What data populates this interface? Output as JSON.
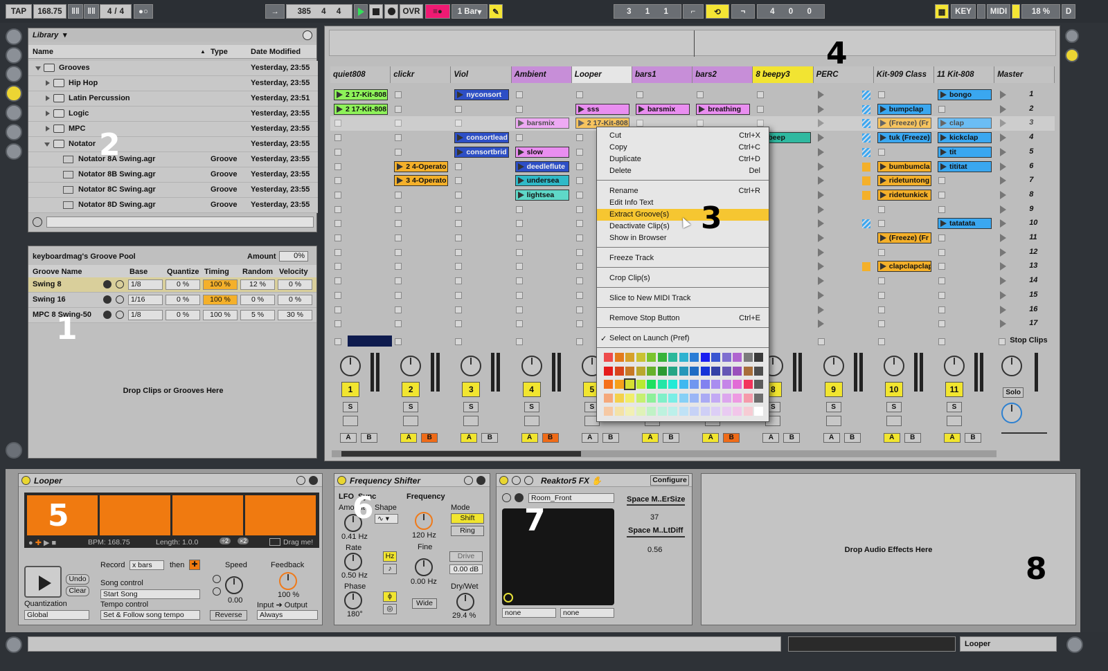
{
  "topbar": {
    "tap": "TAP",
    "tempo": "168.75",
    "sig_num": "4",
    "sig_slash": "/",
    "sig_den": "4",
    "pos_bar": "385",
    "pos_beat": "4",
    "pos_sixt": "4",
    "ovr": "OVR",
    "quant": "1 Bar",
    "loop_bar": "3",
    "loop_beat": "1",
    "loop_sixt": "1",
    "len_bar": "4",
    "len_beat": "0",
    "len_sixt": "0",
    "key": "KEY",
    "midi": "MIDI",
    "cpu": "18 %",
    "d": "D"
  },
  "browser": {
    "title": "Library",
    "col_name": "Name",
    "col_type": "Type",
    "col_date": "Date Modified",
    "rows": [
      {
        "name": "Grooves",
        "type": "",
        "date": "Yesterday, 23:55"
      },
      {
        "name": "Hip Hop",
        "type": "",
        "date": "Yesterday, 23:55"
      },
      {
        "name": "Latin Percussion",
        "type": "",
        "date": "Yesterday, 23:51"
      },
      {
        "name": "Logic",
        "type": "",
        "date": "Yesterday, 23:55"
      },
      {
        "name": "MPC",
        "type": "",
        "date": "Yesterday, 23:55"
      },
      {
        "name": "Notator",
        "type": "",
        "date": "Yesterday, 23:55"
      },
      {
        "name": "Notator 8A Swing.agr",
        "type": "Groove",
        "date": "Yesterday, 23:55"
      },
      {
        "name": "Notator 8B Swing.agr",
        "type": "Groove",
        "date": "Yesterday, 23:55"
      },
      {
        "name": "Notator 8C Swing.agr",
        "type": "Groove",
        "date": "Yesterday, 23:55"
      },
      {
        "name": "Notator 8D Swing.agr",
        "type": "Groove",
        "date": "Yesterday, 23:55"
      }
    ]
  },
  "groove_pool": {
    "title": "keyboardmag's Groove Pool",
    "amount_label": "Amount",
    "amount": "0%",
    "cols": [
      "Groove Name",
      "Base",
      "Quantize",
      "Timing",
      "Random",
      "Velocity"
    ],
    "rows": [
      {
        "name": "Swing 8",
        "base": "1/8",
        "quantize": "0 %",
        "timing": "100 %",
        "random": "12 %",
        "velocity": "0 %"
      },
      {
        "name": "Swing 16",
        "base": "1/16",
        "quantize": "0 %",
        "timing": "100 %",
        "random": "0 %",
        "velocity": "0 %"
      },
      {
        "name": "MPC 8 Swing-50",
        "base": "1/8",
        "quantize": "0 %",
        "timing": "100 %",
        "random": "5 %",
        "velocity": "30 %"
      }
    ],
    "drop": "Drop Clips or Grooves Here"
  },
  "markers": [
    "1",
    "2",
    "3",
    "4",
    "5",
    "6",
    "7",
    "8"
  ],
  "session": {
    "tracks": [
      "quiet808",
      "clickr",
      "Viol",
      "Ambient",
      "Looper",
      "bars1",
      "bars2",
      "8 beepy3",
      "PERC",
      "Kit-909 Class",
      "11 Kit-808",
      "Master"
    ],
    "clips": [
      {
        "track": 0,
        "slot": 0,
        "name": "2 17-Kit-808",
        "color": "#8ef25a"
      },
      {
        "track": 0,
        "slot": 1,
        "name": "2 17-Kit-808",
        "color": "#8ef25a"
      },
      {
        "track": 2,
        "slot": 0,
        "name": "nyconsort",
        "color": "#2d4fc6"
      },
      {
        "track": 2,
        "slot": 3,
        "name": "consortlead",
        "color": "#2d4fc6"
      },
      {
        "track": 2,
        "slot": 4,
        "name": "consortbrid",
        "color": "#2d4fc6"
      },
      {
        "track": 1,
        "slot": 5,
        "name": "2 4-Operato",
        "color": "#f4b02a"
      },
      {
        "track": 1,
        "slot": 6,
        "name": "3 4-Operato",
        "color": "#f4b02a"
      },
      {
        "track": 3,
        "slot": 2,
        "name": "barsmix",
        "color": "#e98ef0"
      },
      {
        "track": 3,
        "slot": 4,
        "name": "slow",
        "color": "#e98ef0"
      },
      {
        "track": 3,
        "slot": 5,
        "name": "deedleflute",
        "color": "#2d4fc6"
      },
      {
        "track": 3,
        "slot": 6,
        "name": "undersea",
        "color": "#2fb9c8"
      },
      {
        "track": 3,
        "slot": 7,
        "name": "lightsea",
        "color": "#5fd8c8"
      },
      {
        "track": 4,
        "slot": 1,
        "name": "sss",
        "color": "#e98ef0"
      },
      {
        "track": 4,
        "slot": 2,
        "name": "2 17-Kit-808",
        "color": "#f4b02a"
      },
      {
        "track": 5,
        "slot": 1,
        "name": "barsmix",
        "color": "#e98ef0"
      },
      {
        "track": 6,
        "slot": 1,
        "name": "breathing",
        "color": "#e98ef0"
      },
      {
        "track": 7,
        "slot": 3,
        "name": "beep",
        "color": "#2fb9a0"
      },
      {
        "track": 9,
        "slot": 1,
        "name": "bumpclap",
        "color": "#3aa7f0"
      },
      {
        "track": 9,
        "slot": 2,
        "name": "(Freeze) (Fr",
        "color": "#f4b02a"
      },
      {
        "track": 9,
        "slot": 3,
        "name": "tuk (Freeze)",
        "color": "#3aa7f0"
      },
      {
        "track": 9,
        "slot": 5,
        "name": "bumbumcla",
        "color": "#f4b02a"
      },
      {
        "track": 9,
        "slot": 6,
        "name": "ridetuntong",
        "color": "#f4b02a"
      },
      {
        "track": 9,
        "slot": 7,
        "name": "ridetunkick",
        "color": "#f4b02a"
      },
      {
        "track": 9,
        "slot": 10,
        "name": "(Freeze) (Fr",
        "color": "#f4b02a"
      },
      {
        "track": 9,
        "slot": 12,
        "name": "clapclapclap",
        "color": "#f4b02a"
      },
      {
        "track": 10,
        "slot": 0,
        "name": "bongo",
        "color": "#3aa7f0"
      },
      {
        "track": 10,
        "slot": 2,
        "name": "clap",
        "color": "#3aa7f0"
      },
      {
        "track": 10,
        "slot": 3,
        "name": "kickclap",
        "color": "#3aa7f0"
      },
      {
        "track": 10,
        "slot": 4,
        "name": "tit",
        "color": "#3aa7f0"
      },
      {
        "track": 10,
        "slot": 5,
        "name": "tititat",
        "color": "#3aa7f0"
      },
      {
        "track": 10,
        "slot": 9,
        "name": "tatatata",
        "color": "#3aa7f0"
      }
    ],
    "scenes": [
      "1",
      "2",
      "3",
      "4",
      "5",
      "6",
      "7",
      "8",
      "9",
      "10",
      "11",
      "12",
      "13",
      "14",
      "15",
      "16",
      "17"
    ],
    "track_numbers": [
      "1",
      "2",
      "3",
      "4",
      "5",
      "6",
      "7",
      "8",
      "9",
      "10",
      "11"
    ],
    "stop_clips": "Stop Clips",
    "solo": "Solo",
    "a": "A",
    "b": "B",
    "s": "S"
  },
  "context_menu": {
    "items": [
      {
        "label": "Cut",
        "shortcut": "Ctrl+X"
      },
      {
        "label": "Copy",
        "shortcut": "Ctrl+C"
      },
      {
        "label": "Duplicate",
        "shortcut": "Ctrl+D"
      },
      {
        "label": "Delete",
        "shortcut": "Del"
      },
      {
        "label": "Rename",
        "shortcut": "Ctrl+R"
      },
      {
        "label": "Edit Info Text",
        "shortcut": ""
      },
      {
        "label": "Extract Groove(s)",
        "shortcut": ""
      },
      {
        "label": "Deactivate Clip(s)",
        "shortcut": ""
      },
      {
        "label": "Show in Browser",
        "shortcut": ""
      },
      {
        "label": "Freeze Track",
        "shortcut": ""
      },
      {
        "label": "Crop Clip(s)",
        "shortcut": ""
      },
      {
        "label": "Slice to New MIDI Track",
        "shortcut": ""
      },
      {
        "label": "Remove Stop Button",
        "shortcut": "Ctrl+E"
      },
      {
        "label": "Select on Launch (Pref)",
        "shortcut": "",
        "checked": true
      }
    ],
    "swatches": [
      "#ee4b4b",
      "#e37b1c",
      "#d6a12a",
      "#c9c232",
      "#7ac42d",
      "#38b33a",
      "#2cb89b",
      "#2fb2d0",
      "#2a7dd6",
      "#1b1ff0",
      "#3a56d1",
      "#7f6fd0",
      "#b065d0",
      "#7b7b7b",
      "#3a3a3a",
      "#e51c1c",
      "#d8441c",
      "#c87925",
      "#b9a82d",
      "#66b12b",
      "#2c9a33",
      "#25a585",
      "#2697b9",
      "#1e6cc4",
      "#1634d8",
      "#3441a7",
      "#6657b5",
      "#9a4fbc",
      "#a86e3a",
      "#4d4d4d",
      "#f5701a",
      "#f6a01a",
      "#d6e032",
      "#b8ea32",
      "#1ee060",
      "#23e6a6",
      "#24ead6",
      "#40b8f0",
      "#6f96f0",
      "#8282f0",
      "#a98df0",
      "#c585e8",
      "#e26bd6",
      "#f2345c",
      "#5b5b5b",
      "#f5a87a",
      "#f4d14a",
      "#f1ee6a",
      "#c6f070",
      "#8df09a",
      "#7ff0c8",
      "#79eee6",
      "#86d0f6",
      "#9ab6f6",
      "#aaaaf4",
      "#c3aaf4",
      "#dca6ee",
      "#ee9ae2",
      "#f59aaa",
      "#6d6d6d",
      "#f6c9a4",
      "#f4e2a6",
      "#f2f0b4",
      "#dff2b8",
      "#c0f2c6",
      "#bdf2de",
      "#bcf0ea",
      "#bfe2f6",
      "#c6d2f6",
      "#cfcff6",
      "#dccef6",
      "#e9cbf2",
      "#f2c6ea",
      "#f6ccd4",
      "#ffffff"
    ]
  },
  "looper": {
    "title": "Looper",
    "bpm": "BPM: 168.75",
    "length": "Length: 1.0.0",
    "x2a": "÷2",
    "x2b": "×2",
    "drag": "Drag me!",
    "undo": "Undo",
    "clear": "Clear",
    "record": "Record",
    "record_val": "x bars",
    "then": "then",
    "speed": "Speed",
    "feedback": "Feedback",
    "feedback_val": "100 %",
    "song_control": "Song control",
    "song_val": "Start Song",
    "tempo_control": "Tempo control",
    "tempo_val": "Set & Follow song tempo",
    "speed_val": "0.00",
    "reverse": "Reverse",
    "quantization": "Quantization",
    "quant_val": "Global",
    "io": "Input ➔ Output",
    "io_val": "Always"
  },
  "freq": {
    "title": "Frequency Shifter",
    "lfo": "LFO",
    "sync": "Sync",
    "amount": "Amount",
    "shape": "Shape",
    "amount_val": "0.41 Hz",
    "rate": "Rate",
    "rate_val": "0.50 Hz",
    "hz": "Hz",
    "phase": "Phase",
    "phase_val": "180°",
    "frequency": "Frequency",
    "freq_val": "120 Hz",
    "mode": "Mode",
    "shift": "Shift",
    "ring": "Ring",
    "fine": "Fine",
    "fine_val": "0.00 Hz",
    "drive": "Drive",
    "drive_val": "0.00 dB",
    "wide": "Wide",
    "drywet": "Dry/Wet",
    "drywet_val": "29.4 %"
  },
  "reaktor": {
    "title": "Reaktor5 FX",
    "configure": "Configure",
    "preset": "Room_Front",
    "p1": "Space M..ErSize",
    "p1v": "37",
    "p2": "Space M..LtDiff",
    "p2v": "0.56",
    "sel1": "none",
    "sel2": "none"
  },
  "drop_fx": "Drop Audio Effects Here",
  "statusbar": {
    "track": "Looper"
  }
}
